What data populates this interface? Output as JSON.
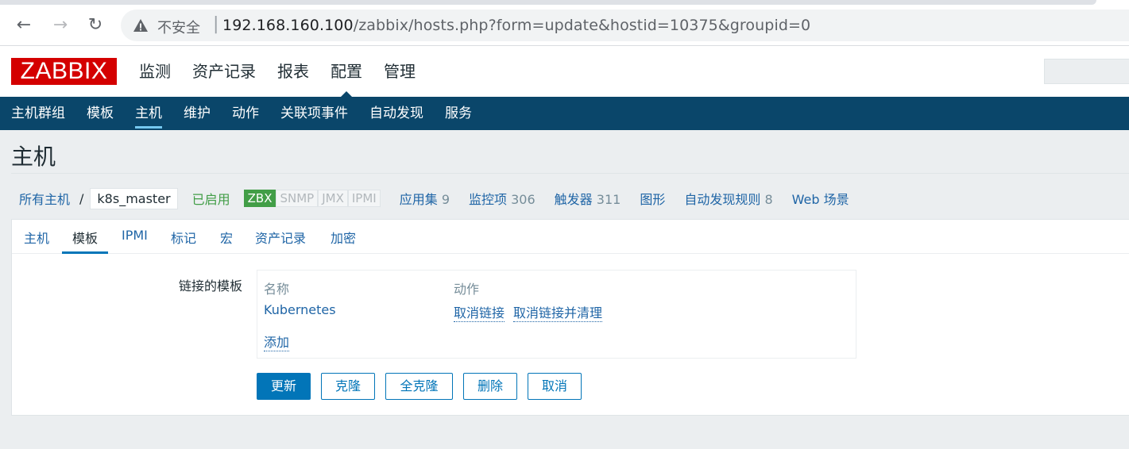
{
  "browser": {
    "insecure_label": "不安全",
    "url_host": "192.168.160.100",
    "url_path": "/zabbix/hosts.php?form=update&hostid=10375&groupid=0"
  },
  "header": {
    "logo": "ZABBIX",
    "menu": [
      "监测",
      "资产记录",
      "报表",
      "配置",
      "管理"
    ],
    "active_menu": "配置"
  },
  "submenu": {
    "items": [
      "主机群组",
      "模板",
      "主机",
      "维护",
      "动作",
      "关联项事件",
      "自动发现",
      "服务"
    ],
    "active": "主机"
  },
  "page": {
    "title": "主机"
  },
  "breadcrumb": {
    "all_hosts": "所有主机",
    "separator": "/",
    "current_host": "k8s_master",
    "status": "已启用",
    "availability": [
      {
        "label": "ZBX",
        "on": true
      },
      {
        "label": "SNMP",
        "on": false
      },
      {
        "label": "JMX",
        "on": false
      },
      {
        "label": "IPMI",
        "on": false
      }
    ],
    "stats": [
      {
        "label": "应用集",
        "count": "9"
      },
      {
        "label": "监控项",
        "count": "306"
      },
      {
        "label": "触发器",
        "count": "311"
      },
      {
        "label": "图形",
        "count": ""
      },
      {
        "label": "自动发现规则",
        "count": "8"
      },
      {
        "label": "Web 场景",
        "count": ""
      }
    ]
  },
  "tabs": [
    "主机",
    "模板",
    "IPMI",
    "标记",
    "宏",
    "资产记录",
    "加密"
  ],
  "active_tab": "模板",
  "form": {
    "linked_templates_label": "链接的模板",
    "col_name": "名称",
    "col_action": "动作",
    "template_name": "Kubernetes",
    "unlink": "取消链接",
    "unlink_clear": "取消链接并清理",
    "add": "添加"
  },
  "buttons": {
    "update": "更新",
    "clone": "克隆",
    "full_clone": "全克隆",
    "delete": "删除",
    "cancel": "取消"
  },
  "colors": {
    "logo_red": "#d40000",
    "nav_blue": "#0a466a",
    "link_blue": "#1f65a6",
    "primary_blue": "#0275b8",
    "enabled_green": "#429e47"
  }
}
